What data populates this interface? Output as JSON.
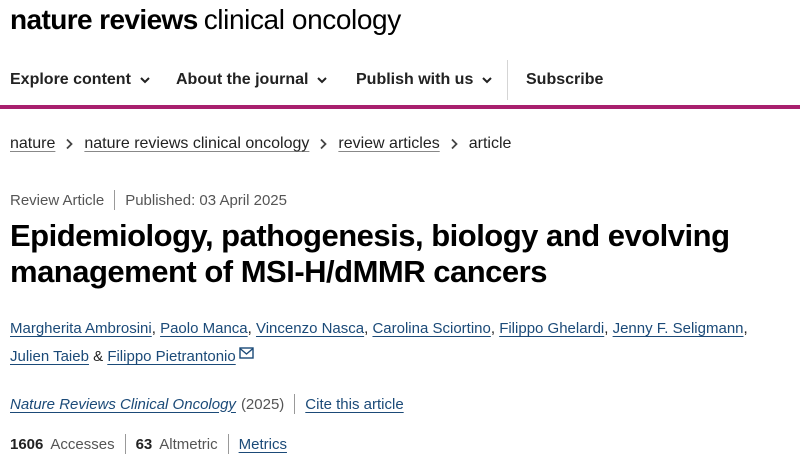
{
  "masthead": {
    "bold": "nature reviews",
    "light": "clinical oncology"
  },
  "nav": [
    {
      "label": "Explore content",
      "chevron": "chevron-down-icon"
    },
    {
      "label": "About the journal",
      "chevron": "chevron-down-icon"
    },
    {
      "label": "Publish with us",
      "chevron": "chevron-down-icon"
    },
    {
      "label": "Subscribe"
    }
  ],
  "colors": {
    "accent_rule": "#a8206e",
    "link": "#1b4a78"
  },
  "breadcrumb": {
    "items": [
      "nature",
      "nature reviews clinical oncology",
      "review articles"
    ],
    "current": "article"
  },
  "article": {
    "type": "Review Article",
    "published": "Published: 03 April 2025",
    "title": "Epidemiology, pathogenesis, biology and evolving management of MSI-H/dMMR cancers",
    "authors": [
      "Margherita Ambrosini",
      "Paolo Manca",
      "Vincenzo Nasca",
      "Carolina Sciortino",
      "Filippo Ghelardi",
      "Jenny F. Seligmann",
      "Julien Taieb",
      "Filippo Pietrantonio"
    ],
    "and": "&",
    "journal": "Nature Reviews Clinical Oncology",
    "year": "(2025)",
    "cite": "Cite this article",
    "accesses_count": "1606",
    "accesses_label": "Accesses",
    "altmetric_count": "63",
    "altmetric_label": "Altmetric",
    "metrics": "Metrics"
  }
}
